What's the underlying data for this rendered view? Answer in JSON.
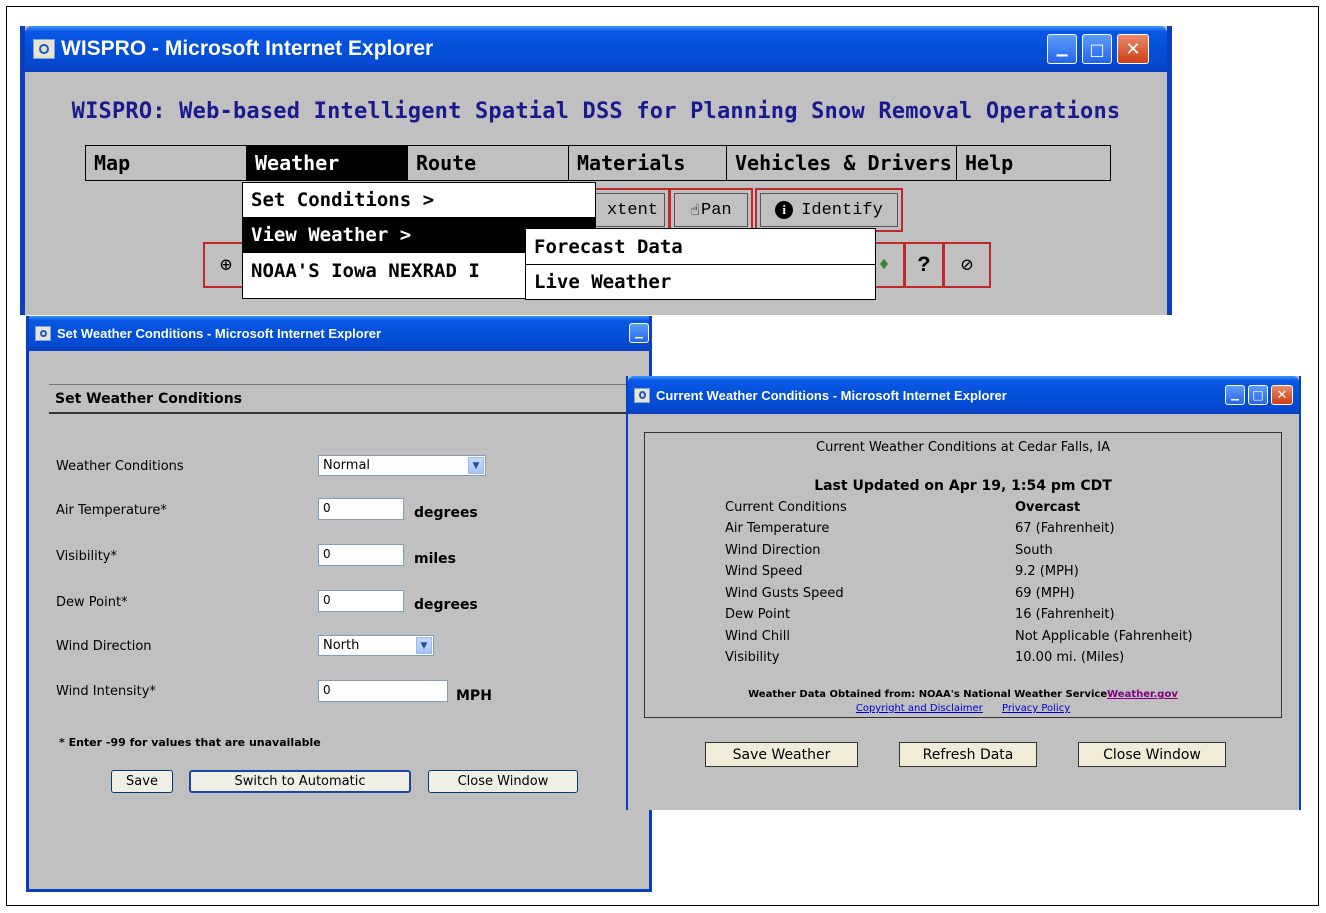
{
  "main_window": {
    "title": "WISPRO - Microsoft Internet Explorer",
    "app_title": "WISPRO: Web-based Intelligent Spatial DSS for Planning Snow Removal Operations",
    "menu": [
      {
        "label": "Map"
      },
      {
        "label": "Weather"
      },
      {
        "label": "Route"
      },
      {
        "label": "Materials"
      },
      {
        "label": "Vehicles & Drivers"
      },
      {
        "label": "Help"
      }
    ],
    "weather_menu": [
      "Set Conditions >",
      "View Weather >",
      "NOAA'S Iowa NEXRAD I"
    ],
    "view_weather_submenu": [
      "Forecast Data",
      "Live Weather"
    ],
    "toolbar": {
      "extent_label": "xtent",
      "pan_label": "Pan",
      "identify_label": "Identify",
      "help_glyph": "?"
    },
    "icons": [
      "zoom-in-icon",
      "hand-icon",
      "info-icon",
      "question-icon",
      "no-icon",
      "tool-icon"
    ]
  },
  "set_window": {
    "title": "Set Weather Conditions - Microsoft Internet Explorer",
    "heading": "Set Weather Conditions",
    "fields": {
      "weather_conditions": {
        "label": "Weather Conditions",
        "value": "Normal"
      },
      "air_temperature": {
        "label": "Air Temperature*",
        "value": "0",
        "unit": "degrees"
      },
      "visibility": {
        "label": "Visibility*",
        "value": "0",
        "unit": "miles"
      },
      "dew_point": {
        "label": "Dew Point*",
        "value": "0",
        "unit": "degrees"
      },
      "wind_direction": {
        "label": "Wind Direction",
        "value": "North"
      },
      "wind_intensity": {
        "label": "Wind Intensity*",
        "value": "0",
        "unit": "MPH"
      }
    },
    "note": "* Enter -99 for values that are unavailable",
    "buttons": {
      "save": "Save",
      "switch": "Switch to Automatic",
      "close": "Close Window"
    }
  },
  "current_window": {
    "title": "Current Weather Conditions - Microsoft Internet Explorer",
    "heading": "Current Weather Conditions at Cedar Falls, IA",
    "updated": "Last Updated on Apr 19, 1:54 pm CDT",
    "rows": [
      {
        "k": "Current Conditions",
        "v": "Overcast"
      },
      {
        "k": "Air Temperature",
        "v": "67 (Fahrenheit)"
      },
      {
        "k": "Wind Direction",
        "v": "South"
      },
      {
        "k": "Wind Speed",
        "v": "9.2 (MPH)"
      },
      {
        "k": "Wind Gusts Speed",
        "v": "69 (MPH)"
      },
      {
        "k": "Dew Point",
        "v": "16 (Fahrenheit)"
      },
      {
        "k": "Wind Chill",
        "v": "Not Applicable (Fahrenheit)"
      },
      {
        "k": "Visibility",
        "v": "10.00 mi. (Miles)"
      }
    ],
    "source_text": "Weather Data Obtained from: NOAA's National Weather Service",
    "source_link": "Weather.gov",
    "copyright_link": "Copyright and Disclaimer",
    "privacy_link": "Privacy Policy",
    "buttons": {
      "save": "Save Weather",
      "refresh": "Refresh Data",
      "close": "Close Window"
    }
  },
  "colors": {
    "title_bar": "#0a58e6",
    "window_bg": "#c0c0c0",
    "app_title": "#1a1a8f",
    "tool_border": "#c0282a"
  }
}
